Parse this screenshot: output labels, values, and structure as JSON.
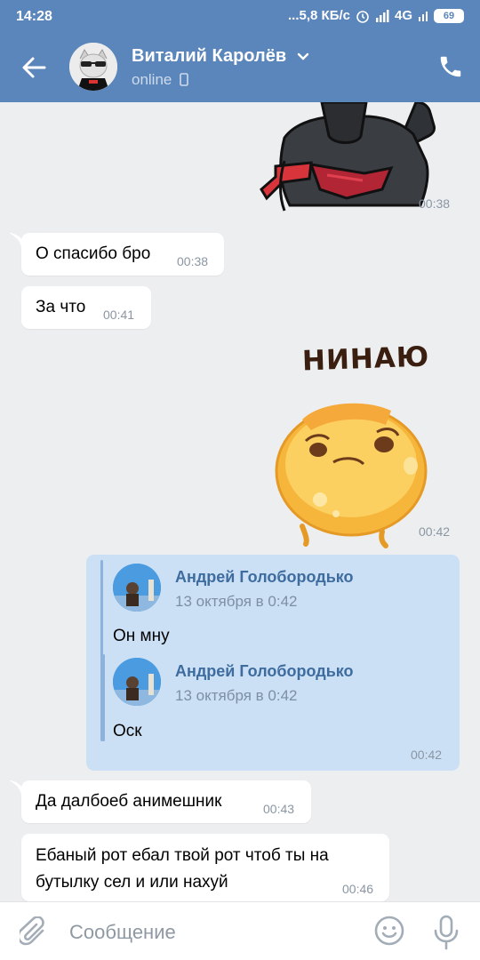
{
  "status_bar": {
    "time": "14:28",
    "network_speed": "...5,8 КБ/с",
    "network_type": "4G",
    "battery": "69"
  },
  "header": {
    "contact_name": "Виталий Каролёв",
    "status": "online",
    "back_icon": "arrow-left-icon",
    "phone_icon": "phone-icon",
    "chevron_icon": "chevron-down-icon"
  },
  "messages": [
    {
      "type": "sticker",
      "direction": "out",
      "sticker": "armored-character",
      "time": "00:38"
    },
    {
      "type": "text",
      "direction": "in",
      "text": "О спасибо бро",
      "time": "00:38"
    },
    {
      "type": "text",
      "direction": "in",
      "text": "За что",
      "time": "00:41"
    },
    {
      "type": "sticker",
      "direction": "out",
      "sticker": "yellow-blob",
      "caption": "НИНАЮ",
      "time": "00:42"
    },
    {
      "type": "forwarded",
      "direction": "out",
      "time": "00:42",
      "forwarded": {
        "author": "Андрей Голобородько",
        "date": "13 октября в 0:42",
        "text": "Он мну",
        "nested": {
          "author": "Андрей Голобородько",
          "date": "13 октября в 0:42",
          "text": "Оск"
        }
      }
    },
    {
      "type": "text",
      "direction": "in",
      "text": "Да далбоеб анимешник",
      "time": "00:43"
    },
    {
      "type": "text",
      "direction": "in",
      "text_line1": "Ебаный рот ебал твой рот чтоб ты на",
      "text_line2": "бутылку сел и или нахуй",
      "time": "00:46"
    }
  ],
  "composer": {
    "placeholder": "Сообщение",
    "value": "",
    "attach_icon": "paperclip-icon",
    "emoji_icon": "smile-icon",
    "mic_icon": "microphone-icon"
  },
  "colors": {
    "header": "#5b86bb",
    "background": "#edeef0",
    "outgoing_bubble": "#cce0f5",
    "incoming_bubble": "#ffffff",
    "link_name": "#3e6c9f"
  }
}
